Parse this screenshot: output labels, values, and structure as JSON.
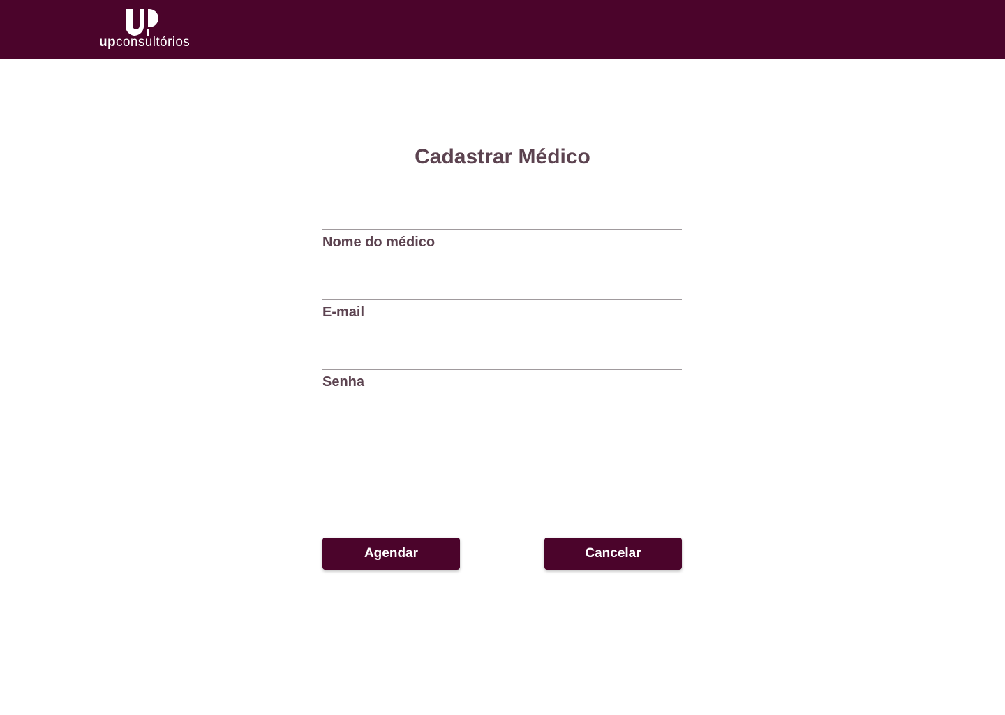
{
  "header": {
    "logo_text_bold": "up",
    "logo_text_light": "consultórios",
    "background_color": "#4b042b"
  },
  "page": {
    "title": "Cadastrar Médico"
  },
  "form": {
    "fields": [
      {
        "label": "Nome do médico",
        "value": ""
      },
      {
        "label": "E-mail",
        "value": ""
      },
      {
        "label": "Senha",
        "value": ""
      }
    ]
  },
  "actions": {
    "submit_label": "Agendar",
    "cancel_label": "Cancelar",
    "button_color": "#4b042b"
  },
  "colors": {
    "title_text": "#5c4350",
    "underline": "#a09a9d"
  }
}
